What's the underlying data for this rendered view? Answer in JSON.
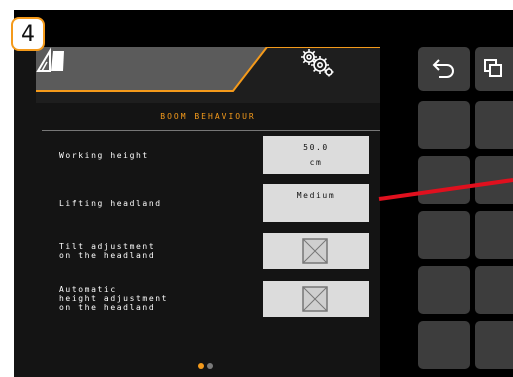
{
  "step_number": "4",
  "section_title": "BOOM BEHAVIOUR",
  "settings": [
    {
      "label": "Working height",
      "value_line1": "50.0",
      "value_line2": "cm"
    },
    {
      "label": "Lifting headland",
      "value_line1": "Medium"
    },
    {
      "label": "Tilt adjustment\non the headland",
      "checked": false
    },
    {
      "label": "Automatic\nheight adjustment\non the headland",
      "checked": false
    }
  ],
  "tabs": [
    {
      "name": "machine",
      "icon": "boom-machine-icon",
      "active": false
    },
    {
      "name": "settings",
      "icon": "gears-icon",
      "active": true
    }
  ],
  "pagination": {
    "total": 2,
    "current": 1
  },
  "side_buttons": {
    "top": [
      "back-icon",
      "copy-icon"
    ]
  },
  "colors": {
    "accent": "#f49a1b",
    "panel": "#141414",
    "value_box": "#dcdcdc",
    "button": "#3d3d3d",
    "pointer_line": "#e0101e"
  }
}
